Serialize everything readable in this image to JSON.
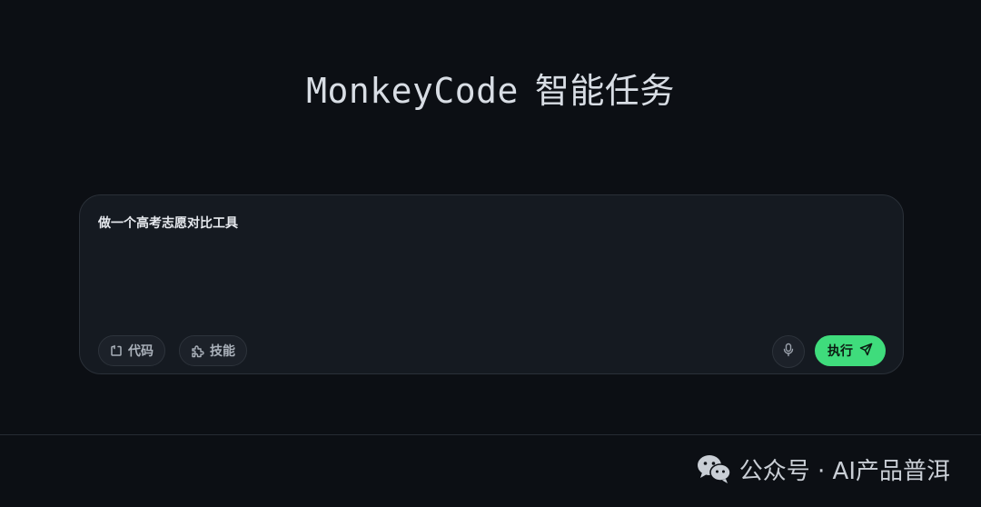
{
  "title": {
    "brand": "MonkeyCode",
    "suffix": "智能任务"
  },
  "composer": {
    "prompt_value": "做一个高考志愿对比工具",
    "chips": [
      {
        "label": "代码",
        "icon": "code-icon"
      },
      {
        "label": "技能",
        "icon": "puzzle-icon"
      }
    ],
    "mic_icon": "mic-icon",
    "run_label": "执行",
    "run_icon": "send-icon"
  },
  "watermark": {
    "icon": "wechat-icon",
    "text": "公众号 · AI产品普洱"
  },
  "colors": {
    "background": "#0c0f14",
    "panel": "#151a21",
    "accent": "#3fdc7c",
    "text": "#d8dde4"
  }
}
